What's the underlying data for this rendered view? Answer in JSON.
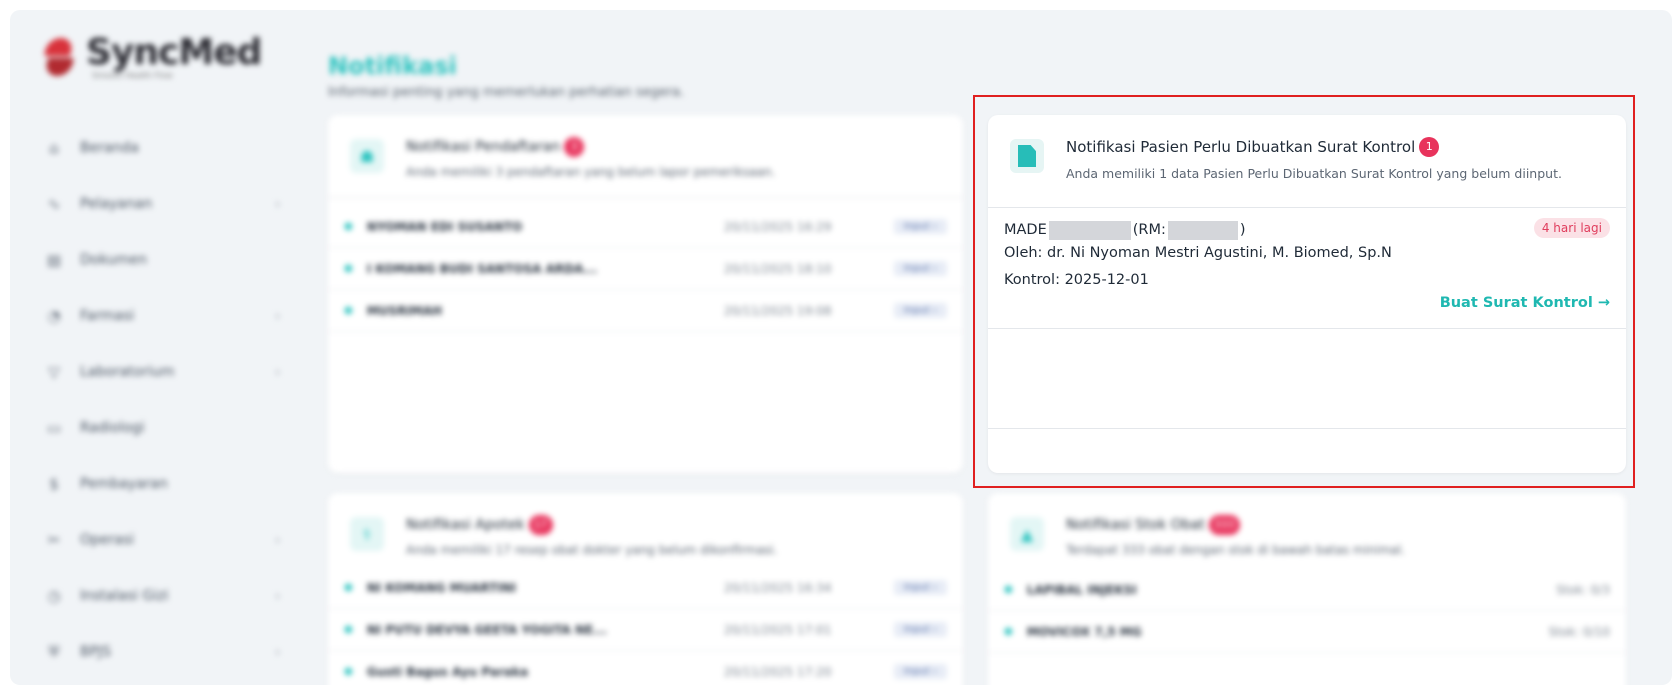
{
  "app": {
    "name": "SyncMed",
    "tagline": "Smooth Health Flow"
  },
  "sidebar": {
    "items": [
      {
        "label": "Beranda",
        "icon": "home-icon",
        "chevron": ""
      },
      {
        "label": "Pelayanan",
        "icon": "stethoscope-icon",
        "chevron": "›"
      },
      {
        "label": "Dokumen",
        "icon": "document-icon",
        "chevron": ""
      },
      {
        "label": "Farmasi",
        "icon": "pill-icon",
        "chevron": "›"
      },
      {
        "label": "Laboratorium",
        "icon": "flask-icon",
        "chevron": "›"
      },
      {
        "label": "Radiologi",
        "icon": "monitor-icon",
        "chevron": ""
      },
      {
        "label": "Pembayaran",
        "icon": "dollar-icon",
        "chevron": ""
      },
      {
        "label": "Operasi",
        "icon": "scissors-icon",
        "chevron": "›"
      },
      {
        "label": "Instalasi Gizi",
        "icon": "food-icon",
        "chevron": "›"
      },
      {
        "label": "BPJS",
        "icon": "shield-icon",
        "chevron": "›"
      }
    ]
  },
  "header": {
    "title": "Notifikasi",
    "subtitle": "Informasi penting yang memerlukan perhatian segera."
  },
  "pendaftaran": {
    "title": "Notifikasi Pendaftaran",
    "badge": "3",
    "subtitle": "Anda memiliki 3 pendaftaran yang belum lapor pemeriksaan.",
    "rows": [
      {
        "name": "NYOMAN EDI SUSANTO",
        "date": "20/11/2025 16:29",
        "action": "Input ›"
      },
      {
        "name": "I KOMANG BUDI SANTOSA ARDA...",
        "date": "20/11/2025 18:10",
        "action": "Input ›"
      },
      {
        "name": "MUSRIMAH",
        "date": "20/11/2025 19:08",
        "action": "Input ›"
      }
    ]
  },
  "surat_kontrol": {
    "title": "Notifikasi Pasien Perlu Dibuatkan Surat Kontrol",
    "badge": "1",
    "subtitle": "Anda memiliki 1 data Pasien Perlu Dibuatkan Surat Kontrol yang belum diinput.",
    "patient": {
      "name_prefix": "MADE",
      "rm_label": "(RM:",
      "rm_close": ")",
      "due": "4 hari lagi",
      "doctor": "Oleh: dr. Ni Nyoman Mestri Agustini, M. Biomed, Sp.N",
      "kontrol": "Kontrol: 2025-12-01"
    },
    "action_label": "Buat Surat Kontrol →"
  },
  "apotek": {
    "title": "Notifikasi Apotek",
    "badge": "17",
    "subtitle": "Anda memiliki 17 resep obat dokter yang belum dikonfirmasi.",
    "rows": [
      {
        "name": "NI KOMANG MUARTINI",
        "date": "20/11/2025 16:34",
        "action": "Input ›"
      },
      {
        "name": "NI PUTU DEVYA GEETA YOGITA NE...",
        "date": "20/11/2025 17:01",
        "action": "Input ›"
      },
      {
        "name": "Gusti Bagus Ayu Paraka",
        "date": "20/11/2025 17:20",
        "action": "Input ›"
      }
    ]
  },
  "stok_obat": {
    "title": "Notifikasi Stok Obat",
    "badge": "333",
    "subtitle": "Terdapat 333 obat dengan stok di bawah batas minimal.",
    "rows": [
      {
        "name": "LAPIBAL INJEKSI",
        "stock": "Stok: 0/3"
      },
      {
        "name": "MOVICOX 7,5 MG",
        "stock": "Stok: 0/10"
      }
    ]
  }
}
